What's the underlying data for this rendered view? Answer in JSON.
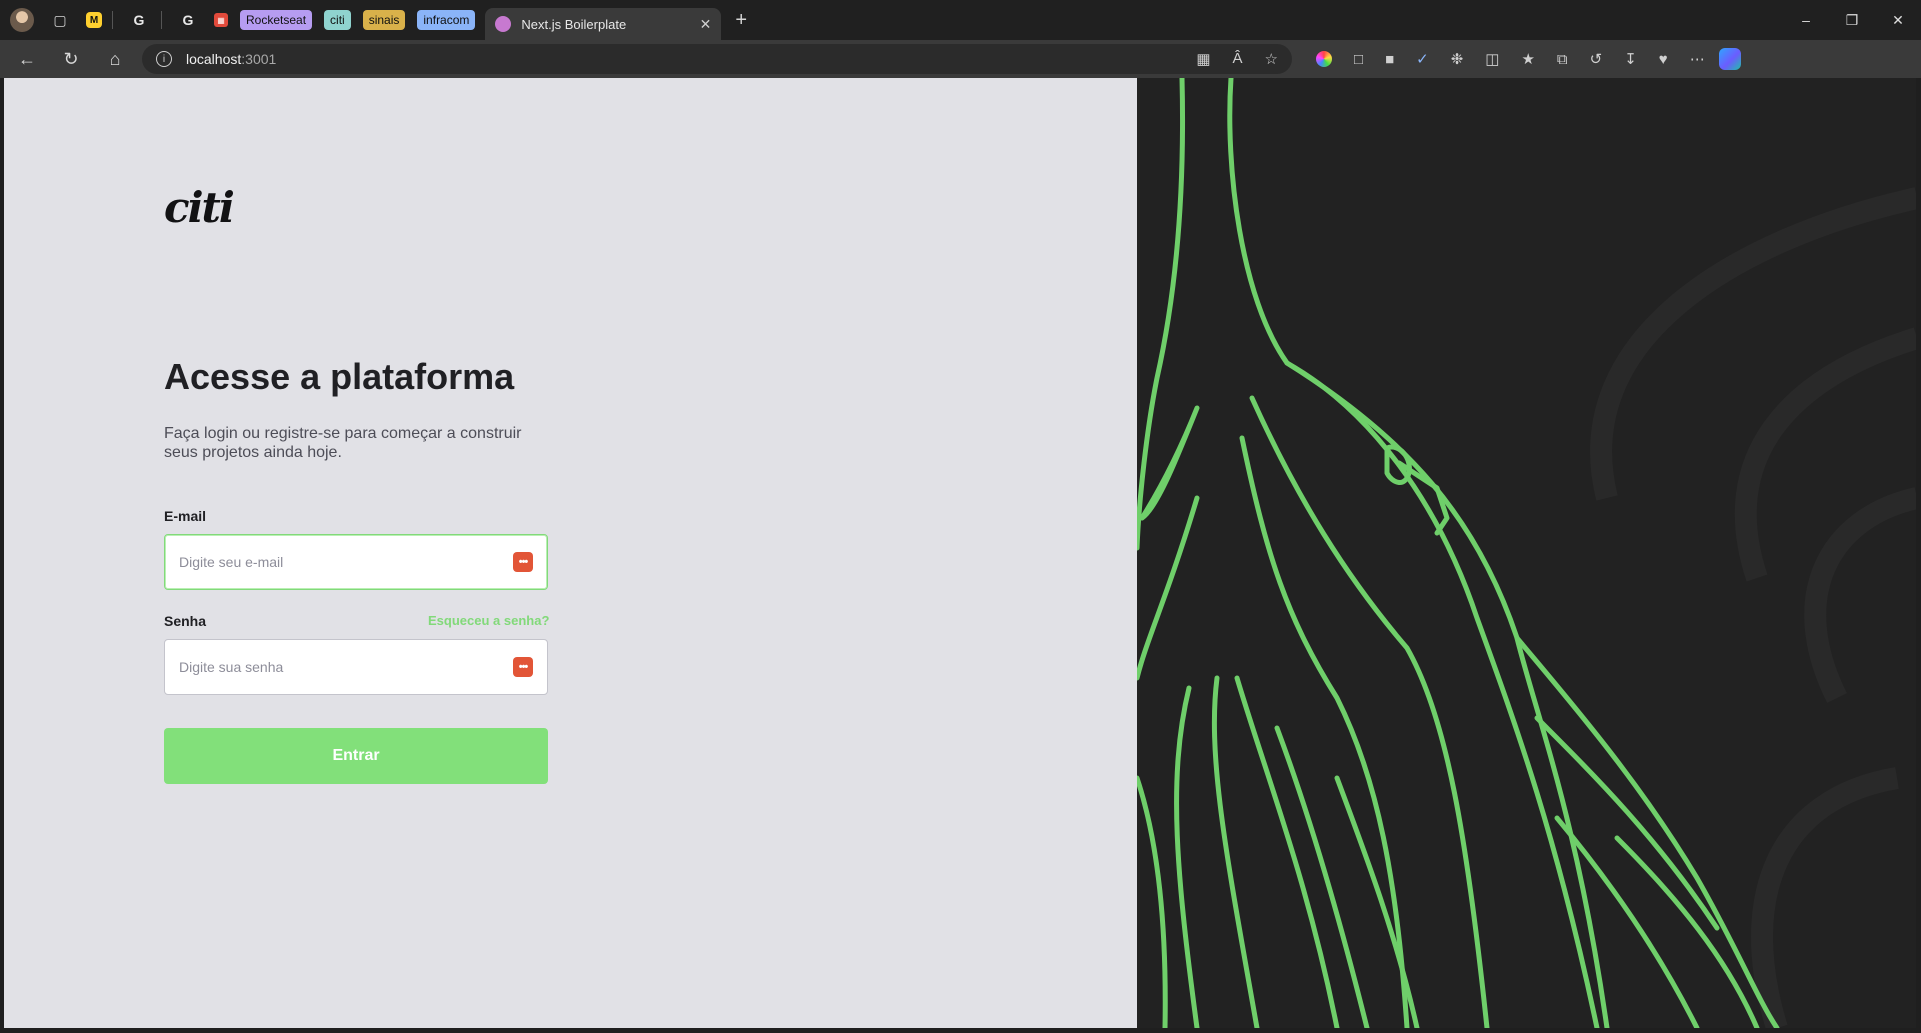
{
  "browser": {
    "tab_groups": [
      {
        "label": "Rocketseat",
        "color": "#b69cf1"
      },
      {
        "label": "citi",
        "color": "#8fd3cf"
      },
      {
        "label": "sinais",
        "color": "#d9b14a"
      },
      {
        "label": "infracom",
        "color": "#8ab4f8"
      }
    ],
    "active_tab_title": "Next.js Boilerplate",
    "address_host": "localhost",
    "address_port": ":3001"
  },
  "login": {
    "logo_text": "citi",
    "heading": "Acesse a plataforma",
    "subtitle": "Faça login ou registre-se para começar a construir seus projetos ainda hoje.",
    "email_label": "E-mail",
    "email_placeholder": "Digite seu e-mail",
    "password_label": "Senha",
    "forgot_link": "Esqueceu a senha?",
    "password_placeholder": "Digite sua senha",
    "submit_label": "Entrar",
    "accent_color": "#82e07a"
  }
}
